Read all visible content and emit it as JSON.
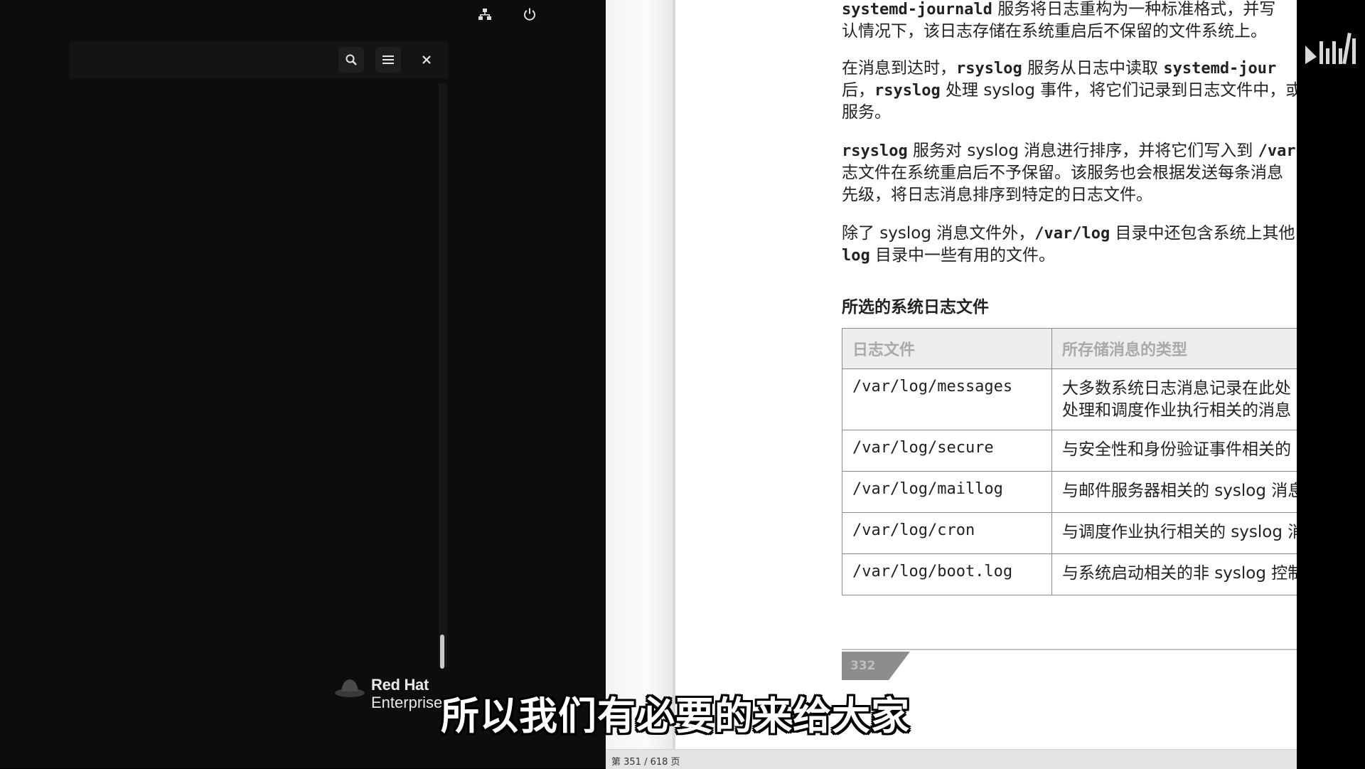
{
  "desktop": {
    "top_icons": [
      "network-icon",
      "power-icon"
    ],
    "terminal": {
      "buttons": [
        "search-icon",
        "menu-icon",
        "close-icon"
      ]
    },
    "brand": {
      "line1": "Red Hat",
      "line2": "Enterprise"
    }
  },
  "document": {
    "paragraphs": {
      "p1": {
        "code1": "systemd-journald",
        "t1": " 服务将日志重构为一种标准格式，并写",
        "line2": "认情况下，该日志存储在系统重启后不保留的文件系统上。"
      },
      "p2": {
        "t1": "在消息到达时，",
        "code1": "rsyslog",
        "t2": " 服务从日志中读取 ",
        "code2": "systemd-jour",
        "line2_pre": "后，",
        "code3": "rsyslog",
        "line2_post": " 处理 syslog 事件，将它们记录到日志文件中，或",
        "line3": "服务。"
      },
      "p3": {
        "code1": "rsyslog",
        "t1": " 服务对 syslog 消息进行排序，并将它们写入到 ",
        "code2": "/var",
        "line2": "志文件在系统重启后不予保留。该服务也会根据发送每条消息",
        "line3": "先级，将日志消息排序到特定的日志文件。"
      },
      "p4": {
        "t1": "除了 syslog 消息文件外，",
        "code1": "/var/log",
        "t2": " 目录中还包含系统上其他",
        "code2": "log",
        "line2": " 目录中一些有用的文件。"
      }
    },
    "section_title": "所选的系统日志文件",
    "table": {
      "headers": [
        "日志文件",
        "所存储消息的类型"
      ],
      "rows": [
        {
          "file": "/var/log/messages",
          "desc1": "大多数系统日志消息记录在此处",
          "desc2": "处理和调度作业执行相关的消息"
        },
        {
          "file": "/var/log/secure",
          "desc1": "与安全性和身份验证事件相关的"
        },
        {
          "file": "/var/log/maillog",
          "desc1": "与邮件服务器相关的 syslog 消息"
        },
        {
          "file": "/var/log/cron",
          "desc1": "与调度作业执行相关的 syslog 消"
        },
        {
          "file": "/var/log/boot.log",
          "desc1": "与系统启动相关的非 syslog 控制"
        }
      ]
    },
    "page_number": "332"
  },
  "status_bar": {
    "text": "第 351 / 618 页"
  },
  "subtitle": "所以我们有必要的来给大家",
  "colors": {
    "desktop_bg": "#0d0d0f",
    "page_bg": "#ffffff",
    "table_header_bg": "#ededed"
  }
}
